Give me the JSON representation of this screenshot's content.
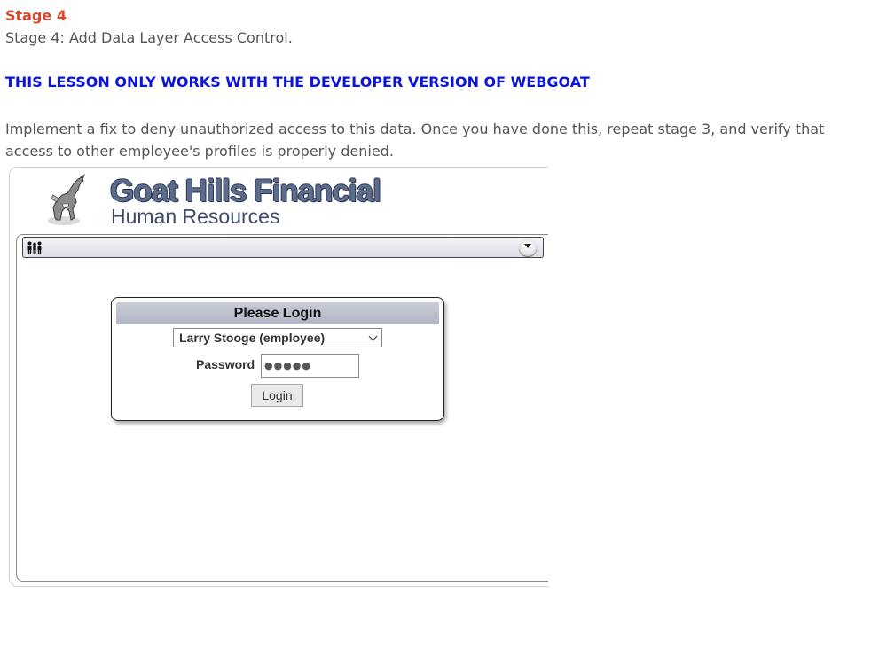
{
  "stage": {
    "heading": "Stage 4",
    "subtitle": "Stage 4: Add Data Layer Access Control."
  },
  "warning": "THIS LESSON ONLY WORKS WITH THE DEVELOPER VERSION OF WEBGOAT",
  "instructions": "Implement a fix to deny unauthorized access to this data. Once you have done this, repeat stage 3, and verify that access to other employee's profiles is properly denied.",
  "app": {
    "brand_title": "Goat Hills Financial",
    "brand_subtitle": "Human Resources",
    "menu": {
      "left_icon": "people-icon",
      "right_icon": "chevron-down-circle-icon"
    },
    "login": {
      "title": "Please Login",
      "selected_user": "Larry Stooge (employee)",
      "password_label": "Password",
      "password_value": "●●●●●",
      "button_label": "Login"
    }
  },
  "colors": {
    "stage_heading": "#d9472b",
    "warning": "#0a14d8",
    "body_text": "#555555",
    "brand": "#5c6c8c"
  }
}
